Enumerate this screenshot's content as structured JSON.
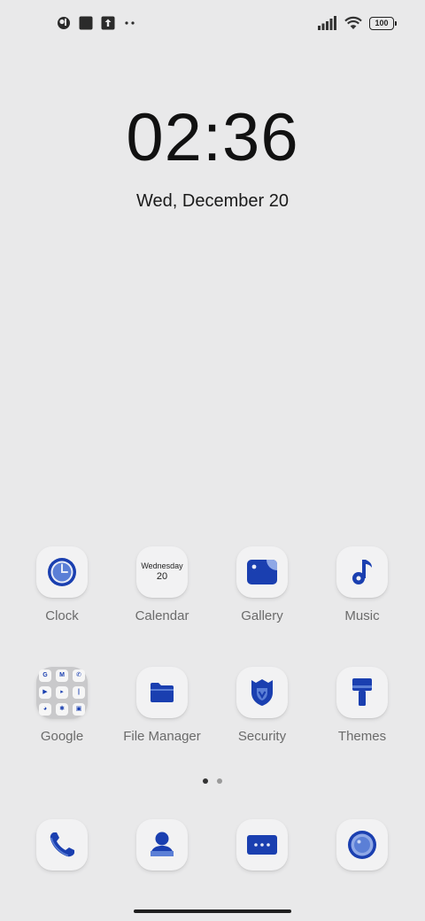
{
  "status_bar": {
    "left_icons": [
      "notification-app-icon",
      "square-notification-icon",
      "upload-notification-icon",
      "more-notifications-dots"
    ],
    "right_icons": [
      "signal-icon",
      "wifi-icon"
    ],
    "battery_level": "100"
  },
  "clock_widget": {
    "time": "02:36",
    "date": "Wed, December 20"
  },
  "calendar_icon": {
    "weekday": "Wednesday",
    "day": "20"
  },
  "apps": {
    "row1": [
      {
        "label": "Clock",
        "icon": "clock-icon"
      },
      {
        "label": "Calendar",
        "icon": "calendar-icon"
      },
      {
        "label": "Gallery",
        "icon": "gallery-icon"
      },
      {
        "label": "Music",
        "icon": "music-note-icon"
      }
    ],
    "row2": [
      {
        "label": "Google",
        "icon": "folder-icon"
      },
      {
        "label": "File Manager",
        "icon": "file-folder-icon"
      },
      {
        "label": "Security",
        "icon": "shield-icon"
      },
      {
        "label": "Themes",
        "icon": "paint-brush-icon"
      }
    ]
  },
  "dock": [
    {
      "icon": "phone-icon"
    },
    {
      "icon": "contacts-icon"
    },
    {
      "icon": "messages-icon"
    },
    {
      "icon": "camera-icon"
    }
  ],
  "google_folder_mini": [
    "G",
    "M",
    "✆",
    "▶",
    "▸",
    "|",
    "◕",
    "✱",
    "▣"
  ],
  "page_indicator": {
    "count": 2,
    "active": 0
  },
  "colors": {
    "accent": "#1a3fb0",
    "background": "#e9e9ea",
    "tile": "#f2f2f3"
  }
}
